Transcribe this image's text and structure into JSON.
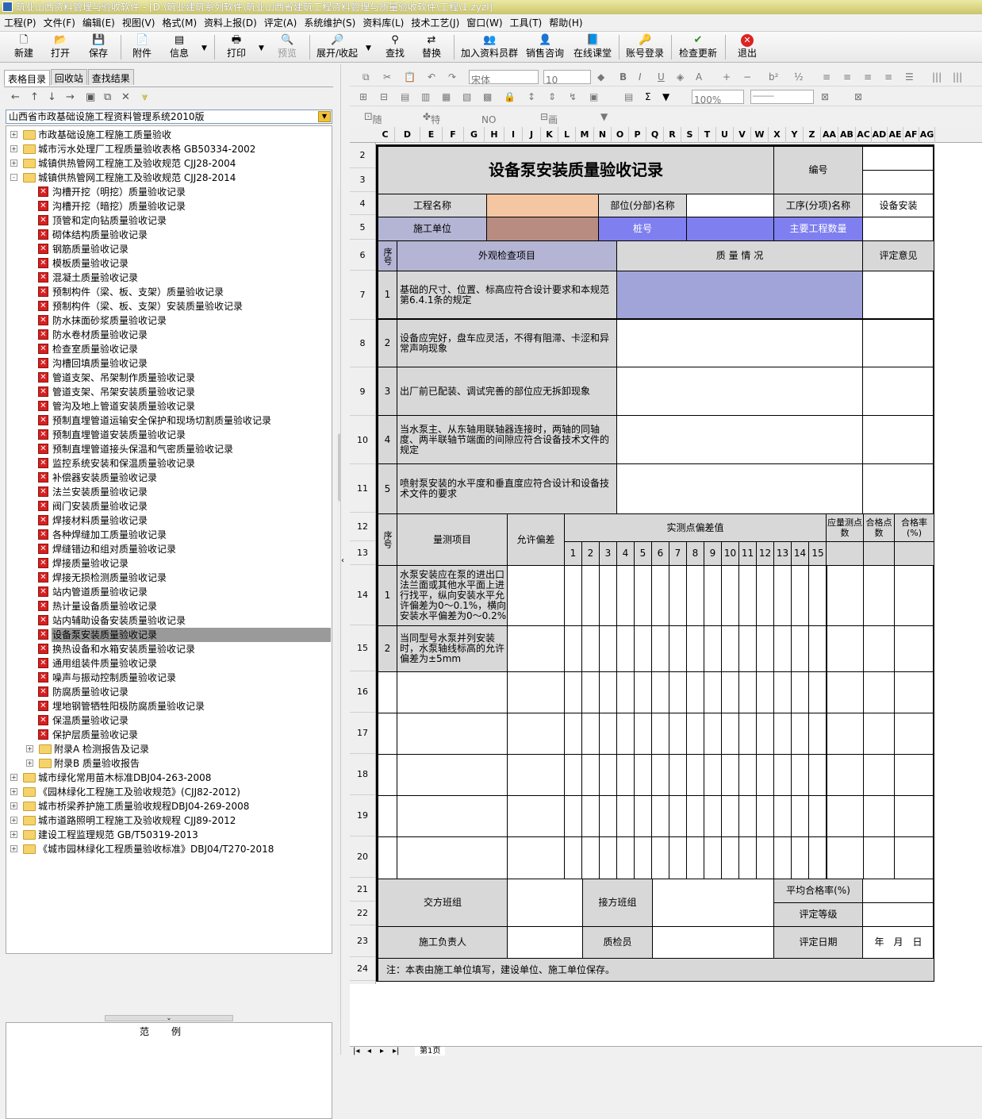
{
  "window": {
    "title": "筑业山西资料管理与验收软件 - [D:\\筑业建筑系列软件\\筑业山西省建筑工程资料管理与质量验收软件\\工程\\1.zyzl]"
  },
  "menu": [
    "工程(P)",
    "文件(F)",
    "编辑(E)",
    "视图(V)",
    "格式(M)",
    "资料上报(D)",
    "评定(A)",
    "系统维护(S)",
    "资料库(L)",
    "技术工艺(J)",
    "窗口(W)",
    "工具(T)",
    "帮助(H)"
  ],
  "toolbar": {
    "new": "新建",
    "open": "打开",
    "save": "保存",
    "attach": "附件",
    "info": "信息",
    "print": "打印",
    "preview": "预览",
    "expand": "展开/收起",
    "find": "查找",
    "replace": "替换",
    "join": "加入资料员群",
    "consult": "销售咨询",
    "online": "在线课堂",
    "login": "账号登录",
    "update": "检查更新",
    "exit": "退出"
  },
  "left": {
    "tabs": [
      "表格目录",
      "回收站",
      "查找结果"
    ],
    "combo": "山西省市政基础设施工程资料管理系统2010版",
    "legend": "范例",
    "tree": [
      {
        "lvl": 0,
        "exp": "+",
        "icon": "folder",
        "text": "市政基础设施工程施工质量验收"
      },
      {
        "lvl": 0,
        "exp": "+",
        "icon": "folder",
        "text": "城市污水处理厂工程质量验收表格 GB50334-2002"
      },
      {
        "lvl": 0,
        "exp": "+",
        "icon": "folder",
        "text": "城镇供热管网工程施工及验收规范 CJJ28-2004"
      },
      {
        "lvl": 0,
        "exp": "-",
        "icon": "folder",
        "text": "城镇供热管网工程施工及验收规范 CJJ28-2014"
      },
      {
        "lvl": 1,
        "icon": "doc",
        "text": "沟槽开挖（明挖）质量验收记录"
      },
      {
        "lvl": 1,
        "icon": "doc",
        "text": "沟槽开挖（暗挖）质量验收记录"
      },
      {
        "lvl": 1,
        "icon": "doc",
        "text": "顶管和定向钻质量验收记录"
      },
      {
        "lvl": 1,
        "icon": "doc",
        "text": "砌体结构质量验收记录"
      },
      {
        "lvl": 1,
        "icon": "doc",
        "text": "钢筋质量验收记录"
      },
      {
        "lvl": 1,
        "icon": "doc",
        "text": "模板质量验收记录"
      },
      {
        "lvl": 1,
        "icon": "doc",
        "text": "混凝土质量验收记录"
      },
      {
        "lvl": 1,
        "icon": "doc",
        "text": "预制构件（梁、板、支架）质量验收记录"
      },
      {
        "lvl": 1,
        "icon": "doc",
        "text": "预制构件（梁、板、支架）安装质量验收记录"
      },
      {
        "lvl": 1,
        "icon": "doc",
        "text": "防水抹面砂浆质量验收记录"
      },
      {
        "lvl": 1,
        "icon": "doc",
        "text": "防水卷材质量验收记录"
      },
      {
        "lvl": 1,
        "icon": "doc",
        "text": "检查室质量验收记录"
      },
      {
        "lvl": 1,
        "icon": "doc",
        "text": "沟槽回填质量验收记录"
      },
      {
        "lvl": 1,
        "icon": "doc",
        "text": "管道支架、吊架制作质量验收记录"
      },
      {
        "lvl": 1,
        "icon": "doc",
        "text": "管道支架、吊架安装质量验收记录"
      },
      {
        "lvl": 1,
        "icon": "doc",
        "text": "管沟及地上管道安装质量验收记录"
      },
      {
        "lvl": 1,
        "icon": "doc",
        "text": "预制直埋管道运输安全保护和现场切割质量验收记录"
      },
      {
        "lvl": 1,
        "icon": "doc",
        "text": "预制直埋管道安装质量验收记录"
      },
      {
        "lvl": 1,
        "icon": "doc",
        "text": "预制直埋管道接头保温和气密质量验收记录"
      },
      {
        "lvl": 1,
        "icon": "doc",
        "text": "监控系统安装和保温质量验收记录"
      },
      {
        "lvl": 1,
        "icon": "doc",
        "text": "补偿器安装质量验收记录"
      },
      {
        "lvl": 1,
        "icon": "doc",
        "text": "法兰安装质量验收记录"
      },
      {
        "lvl": 1,
        "icon": "doc",
        "text": "阀门安装质量验收记录"
      },
      {
        "lvl": 1,
        "icon": "doc",
        "text": "焊接材料质量验收记录"
      },
      {
        "lvl": 1,
        "icon": "doc",
        "text": "各种焊缝加工质量验收记录"
      },
      {
        "lvl": 1,
        "icon": "doc",
        "text": "焊缝错边和组对质量验收记录"
      },
      {
        "lvl": 1,
        "icon": "doc",
        "text": "焊接质量验收记录"
      },
      {
        "lvl": 1,
        "icon": "doc",
        "text": "焊接无损检测质量验收记录"
      },
      {
        "lvl": 1,
        "icon": "doc",
        "text": "站内管道质量验收记录"
      },
      {
        "lvl": 1,
        "icon": "doc",
        "text": "热计量设备质量验收记录"
      },
      {
        "lvl": 1,
        "icon": "doc",
        "text": "站内辅助设备安装质量验收记录"
      },
      {
        "lvl": 1,
        "icon": "doc",
        "text": "设备泵安装质量验收记录",
        "sel": true
      },
      {
        "lvl": 1,
        "icon": "doc",
        "text": "换热设备和水箱安装质量验收记录"
      },
      {
        "lvl": 1,
        "icon": "doc",
        "text": "通用组装件质量验收记录"
      },
      {
        "lvl": 1,
        "icon": "doc",
        "text": "噪声与振动控制质量验收记录"
      },
      {
        "lvl": 1,
        "icon": "doc",
        "text": "防腐质量验收记录"
      },
      {
        "lvl": 1,
        "icon": "doc",
        "text": "埋地钢管牺牲阳极防腐质量验收记录"
      },
      {
        "lvl": 1,
        "icon": "doc",
        "text": "保温质量验收记录"
      },
      {
        "lvl": 1,
        "icon": "doc",
        "text": "保护层质量验收记录"
      },
      {
        "lvl": 1,
        "exp": "+",
        "icon": "folder",
        "text": "附录A 检测报告及记录"
      },
      {
        "lvl": 1,
        "exp": "+",
        "icon": "folder",
        "text": "附录B 质量验收报告"
      },
      {
        "lvl": 0,
        "exp": "+",
        "icon": "folder",
        "text": "城市绿化常用苗木标准DBJ04-263-2008"
      },
      {
        "lvl": 0,
        "exp": "+",
        "icon": "folder",
        "text": "《园林绿化工程施工及验收规范》(CJJ82-2012)"
      },
      {
        "lvl": 0,
        "exp": "+",
        "icon": "folder",
        "text": "城市桥梁养护施工质量验收规程DBJ04-269-2008"
      },
      {
        "lvl": 0,
        "exp": "+",
        "icon": "folder",
        "text": "城市道路照明工程施工及验收规程 CJJ89-2012"
      },
      {
        "lvl": 0,
        "exp": "+",
        "icon": "folder",
        "text": "建设工程监理规范 GB/T50319-2013"
      },
      {
        "lvl": 0,
        "exp": "+",
        "icon": "folder",
        "text": "《城市园林绿化工程质量验收标准》DBJ04/T270-2018"
      }
    ]
  },
  "right": {
    "font": "宋体",
    "size": "10",
    "zoom": "100%",
    "tb3": [
      "随机数",
      "特殊符号",
      "NO 重新编号",
      "画删除线"
    ],
    "cols": [
      "C",
      "D",
      "E",
      "F",
      "G",
      "H",
      "I",
      "J",
      "K",
      "L",
      "M",
      "N",
      "O",
      "P",
      "Q",
      "R",
      "S",
      "T",
      "U",
      "V",
      "W",
      "X",
      "Y",
      "Z",
      "AA",
      "AB",
      "AC",
      "AD",
      "AE",
      "AF",
      "AG"
    ],
    "rows": [
      "2",
      "3",
      "4",
      "5",
      "6",
      "7",
      "8",
      "9",
      "10",
      "11",
      "12",
      "13",
      "14",
      "15",
      "16",
      "17",
      "18",
      "19",
      "20",
      "21",
      "22",
      "23",
      "24"
    ],
    "sheettab": "第1页"
  },
  "form": {
    "title": "设备泵安装质量验收记录",
    "code_label": "编号",
    "project_name": "工程名称",
    "part_name": "部位(分部)名称",
    "process_name": "工序(分项)名称",
    "process_value": "设备安装",
    "constructor": "施工单位",
    "pile": "桩号",
    "quantity": "主要工程数量",
    "seq": "序号",
    "appearance": "外观检查项目",
    "quality": "质 量 情 况",
    "opinion": "评定意见",
    "items": [
      {
        "n": "1",
        "t": "基础的尺寸、位置、标高应符合设计要求和本规范第6.4.1条的规定"
      },
      {
        "n": "2",
        "t": "设备应完好，盘车应灵活，不得有阻滞、卡涩和异常声响现象"
      },
      {
        "n": "3",
        "t": "出厂前已配装、调试完善的部位应无拆卸现象"
      },
      {
        "n": "4",
        "t": "当水泵主、从东轴用联轴器连接时，两轴的同轴度、两半联轴节端面的间隙应符合设备技术文件的规定"
      },
      {
        "n": "5",
        "t": "喷射泵安装的水平度和垂直度应符合设计和设备技术文件的要求"
      }
    ],
    "measure": "量测项目",
    "allow": "允许偏差",
    "actual": "实测点偏差值",
    "should": "应量测点数",
    "pass": "合格点数",
    "rate": "合格率(%)",
    "nums": [
      "1",
      "2",
      "3",
      "4",
      "5",
      "6",
      "7",
      "8",
      "9",
      "10",
      "11",
      "12",
      "13",
      "14",
      "15"
    ],
    "meas_items": [
      {
        "n": "1",
        "t": "水泵安装应在泵的进出口法兰面或其他水平面上进行找平，纵向安装水平允许偏差为0～0.1%，横向安装水平偏差为0～0.2%"
      },
      {
        "n": "2",
        "t": "当同型号水泵并列安装时，水泵轴线标高的允许偏差为±5mm"
      }
    ],
    "handover": "交方班组",
    "receiver": "接方班组",
    "avg_rate": "平均合格率(%)",
    "grade": "评定等级",
    "leader": "施工负责人",
    "inspector": "质检员",
    "eval_date": "评定日期",
    "date": "年　月　日",
    "note": "注：本表由施工单位填写，建设单位、施工单位保存。"
  }
}
